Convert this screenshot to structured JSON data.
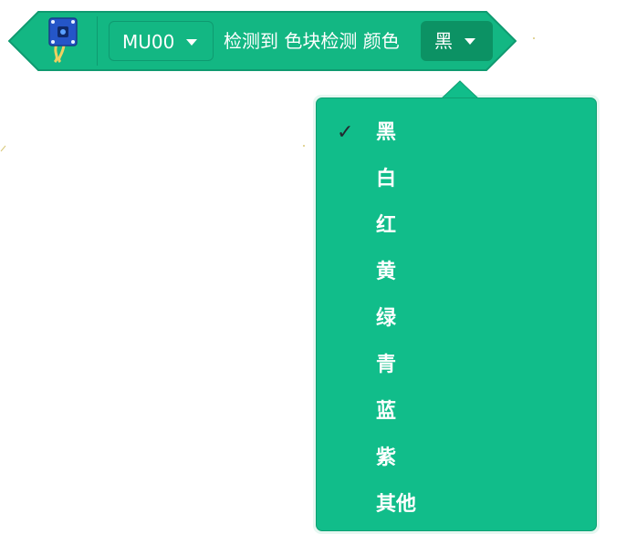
{
  "block": {
    "extension_icon": "sensor-module-icon",
    "sensor_dropdown": {
      "value": "MU00",
      "icon": "caret-down-icon"
    },
    "text": "检测到 色块检测 颜色",
    "color_dropdown": {
      "value": "黑",
      "icon": "caret-down-icon"
    },
    "colors": {
      "fill": "#13b783",
      "border": "#0f9a70",
      "dropdown_active": "#0c9264"
    }
  },
  "menu": {
    "selected_index": 0,
    "check_glyph": "✓",
    "items": [
      {
        "label": "黑",
        "selected": true
      },
      {
        "label": "白",
        "selected": false
      },
      {
        "label": "红",
        "selected": false
      },
      {
        "label": "黄",
        "selected": false
      },
      {
        "label": "绿",
        "selected": false
      },
      {
        "label": "青",
        "selected": false
      },
      {
        "label": "蓝",
        "selected": false
      },
      {
        "label": "紫",
        "selected": false
      },
      {
        "label": "其他",
        "selected": false
      }
    ],
    "colors": {
      "background": "#11bd8a",
      "text": "#ffffff",
      "check": "#222a30"
    }
  }
}
